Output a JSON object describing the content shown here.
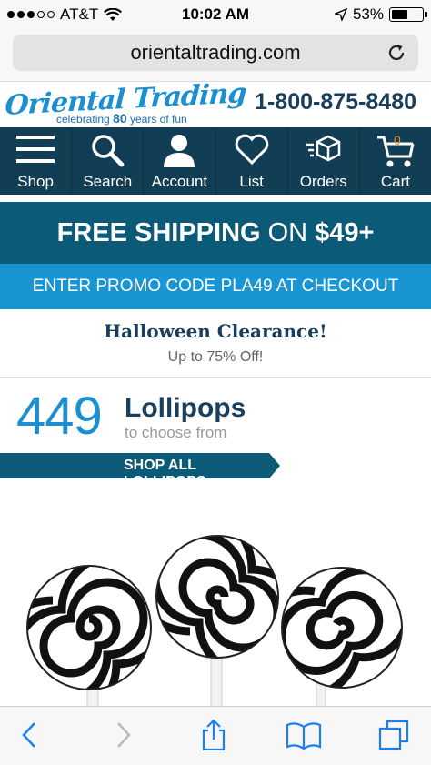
{
  "status": {
    "carrier": "AT&T",
    "time": "10:02 AM",
    "battery": "53%",
    "battery_level": 0.53,
    "signal_bars": 3
  },
  "address_bar": {
    "url": "orientaltrading.com"
  },
  "header": {
    "brand": "Oriental Trading",
    "tagline_pre": "celebrating",
    "tagline_num": "80",
    "tagline_post": "years of fun",
    "phone": "1-800-875-8480"
  },
  "nav": {
    "items": [
      {
        "label": "Shop",
        "icon": "menu-icon"
      },
      {
        "label": "Search",
        "icon": "search-icon"
      },
      {
        "label": "Account",
        "icon": "account-icon"
      },
      {
        "label": "List",
        "icon": "heart-icon"
      },
      {
        "label": "Orders",
        "icon": "orders-box-icon"
      },
      {
        "label": "Cart",
        "icon": "cart-icon",
        "count": "0"
      }
    ]
  },
  "promo": {
    "shipping_prefix": "FREE SHIPPING",
    "shipping_on": "ON",
    "shipping_amount": "$49+",
    "code_text": "ENTER PROMO CODE PLA49 AT CHECKOUT"
  },
  "sale": {
    "title": "Halloween Clearance!",
    "subtitle": "Up to 75% Off!"
  },
  "lollipops": {
    "count": "449",
    "title": "Lollipops",
    "subtitle": "to choose from",
    "button": "SHOP ALL LOLLIPOPS"
  },
  "colors": {
    "navy": "#123e55",
    "brand_blue": "#1c8fd1",
    "promo_dark": "#0b5a78",
    "promo_light": "#1995d4",
    "ios_blue": "#1a7ff5",
    "cart_orange": "#f08c1a"
  }
}
